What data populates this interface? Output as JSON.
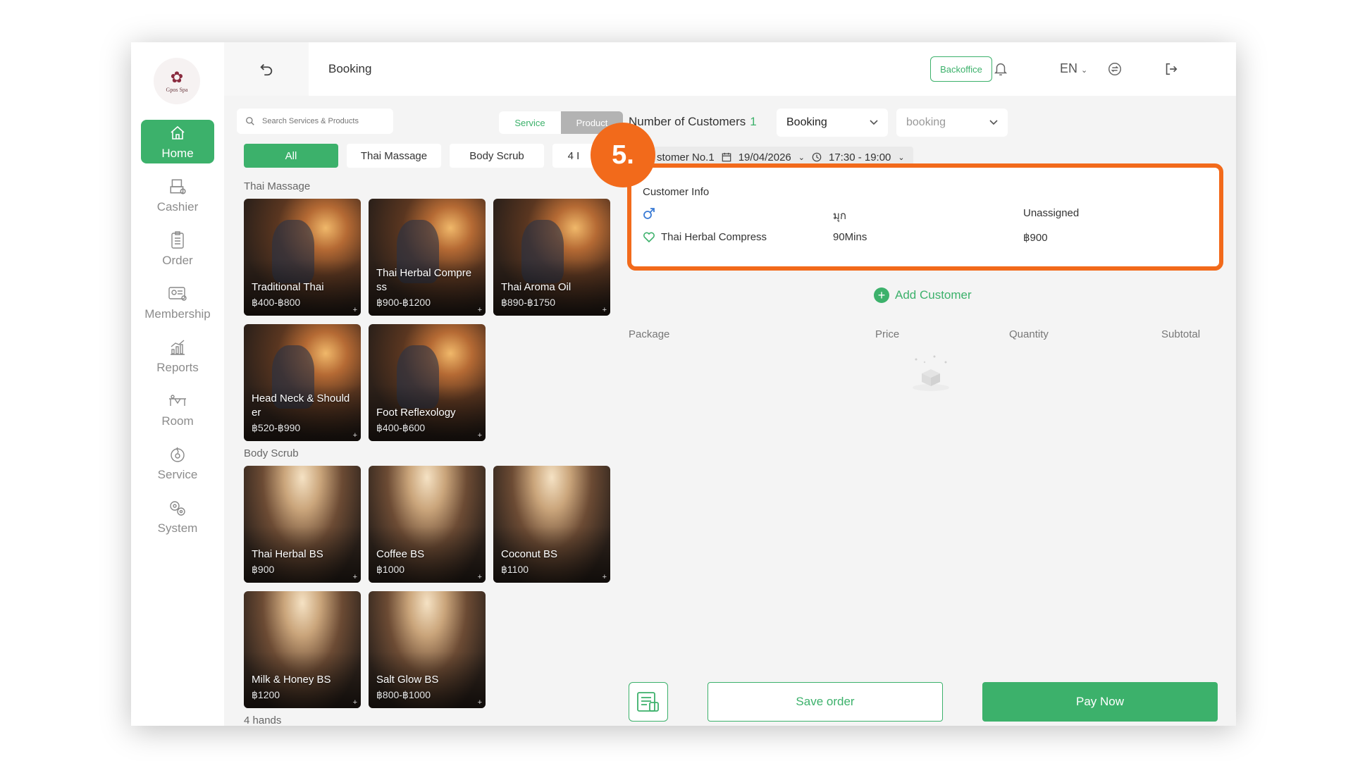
{
  "logo": {
    "text": "Gpos Spa"
  },
  "sidebar": {
    "items": [
      {
        "label": "Home",
        "icon": "home-icon",
        "active": true
      },
      {
        "label": "Cashier",
        "icon": "cashier-icon"
      },
      {
        "label": "Order",
        "icon": "order-icon"
      },
      {
        "label": "Membership",
        "icon": "membership-icon"
      },
      {
        "label": "Reports",
        "icon": "reports-icon"
      },
      {
        "label": "Room",
        "icon": "room-icon"
      },
      {
        "label": "Service",
        "icon": "service-icon"
      },
      {
        "label": "System",
        "icon": "system-icon"
      }
    ]
  },
  "topbar": {
    "title": "Booking",
    "backoffice": "Backoffice",
    "language": "EN"
  },
  "search": {
    "placeholder": "Search Services & Products"
  },
  "segment": {
    "service": "Service",
    "product": "Product"
  },
  "categories": [
    "All",
    "Thai Massage",
    "Body Scrub",
    "4 I"
  ],
  "sections": {
    "thai_massage": "Thai Massage",
    "body_scrub": "Body Scrub",
    "four_hands": "4 hands"
  },
  "cards": {
    "thai_massage": [
      {
        "name": "Traditional Thai",
        "price": "฿400-฿800"
      },
      {
        "name": "Thai Herbal Compre ss",
        "price": "฿900-฿1200"
      },
      {
        "name": "Thai Aroma Oil",
        "price": "฿890-฿1750"
      },
      {
        "name": "Head Neck & Should er",
        "price": "฿520-฿990"
      },
      {
        "name": "Foot Reflexology",
        "price": "฿400-฿600"
      }
    ],
    "body_scrub": [
      {
        "name": "Thai Herbal BS",
        "price": "฿900"
      },
      {
        "name": "Coffee BS",
        "price": "฿1000"
      },
      {
        "name": "Coconut BS",
        "price": "฿1100"
      },
      {
        "name": "Milk & Honey BS",
        "price": "฿1200"
      },
      {
        "name": "Salt Glow BS",
        "price": "฿800-฿1000"
      }
    ]
  },
  "booking": {
    "num_customers_label": "Number of Customers",
    "num_customers": "1",
    "type_select": "Booking",
    "status_select": "booking",
    "customer_label": "stomer No.1",
    "date": "19/04/2026",
    "time": "17:30 - 19:00"
  },
  "badge": "5.",
  "customer_info": {
    "header": "Customer Info",
    "row1": {
      "col2": "มุก",
      "col3": "Unassigned"
    },
    "row2": {
      "service": "Thai Herbal Compress",
      "duration": "90Mins",
      "price": "฿900"
    }
  },
  "add_customer": "Add Customer",
  "table_headers": {
    "package": "Package",
    "price": "Price",
    "quantity": "Quantity",
    "subtotal": "Subtotal"
  },
  "actions": {
    "save": "Save order",
    "pay": "Pay Now"
  },
  "colors": {
    "accent": "#3cb16b",
    "highlight": "#f26a1b",
    "male": "#3a7bd5"
  }
}
